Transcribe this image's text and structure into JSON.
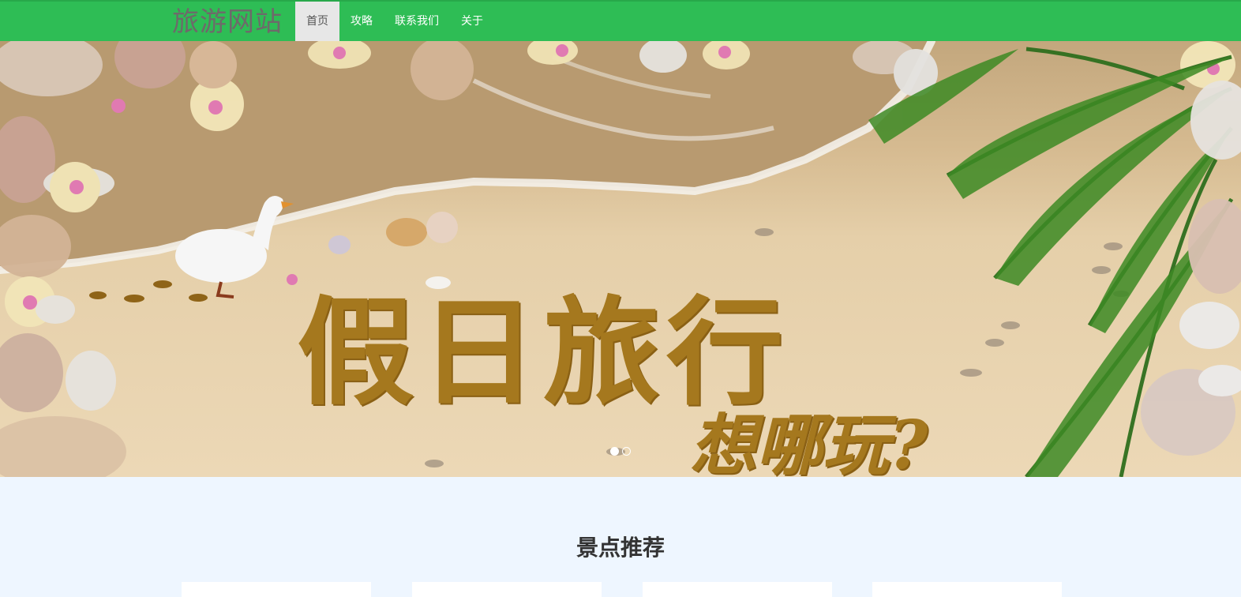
{
  "navbar": {
    "brand": "旅游网站",
    "items": [
      {
        "label": "首页",
        "active": true
      },
      {
        "label": "攻略",
        "active": false
      },
      {
        "label": "联系我们",
        "active": false
      },
      {
        "label": "关于",
        "active": false
      }
    ],
    "color": "#2ebd55"
  },
  "banner": {
    "headline": "假日旅行",
    "subline": "想哪玩?",
    "slides": 2,
    "active_slide": 1
  },
  "section": {
    "title": "景点推荐"
  }
}
